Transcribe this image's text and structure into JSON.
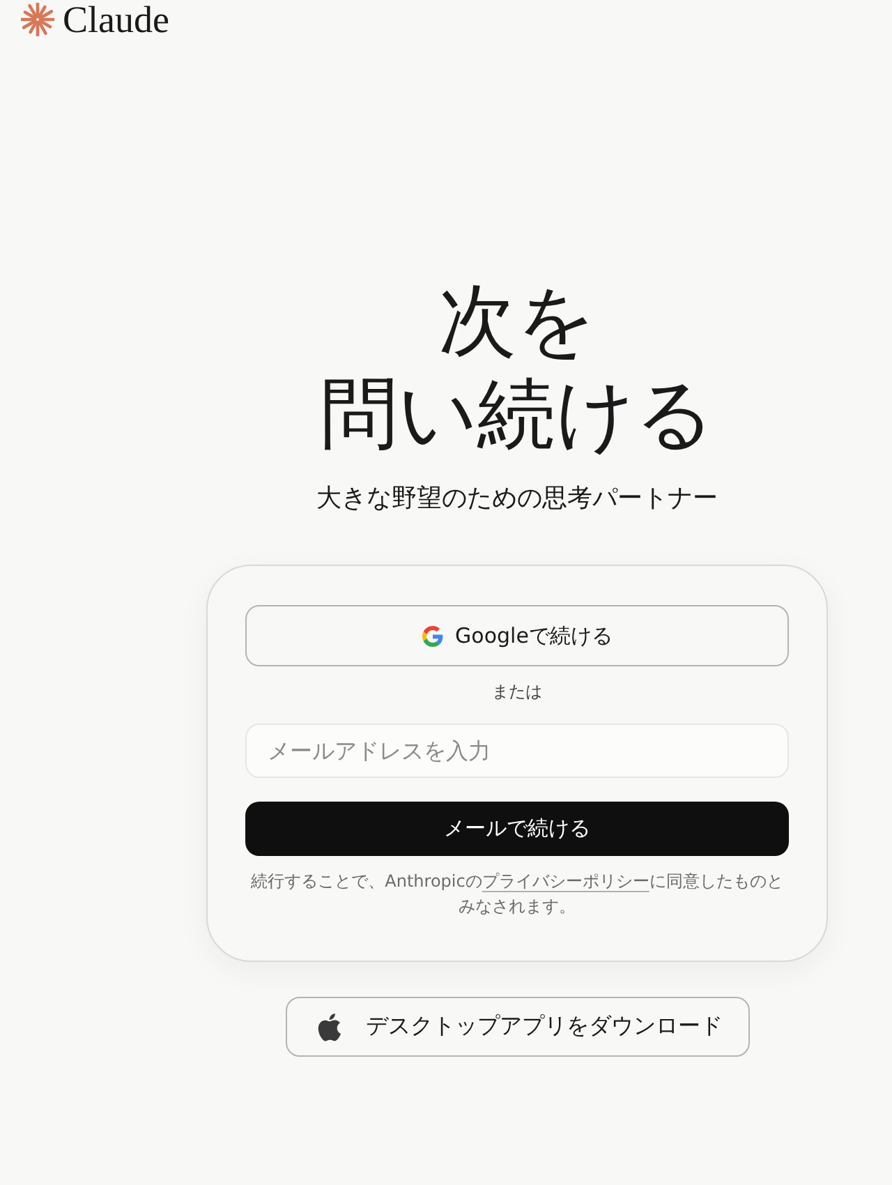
{
  "header": {
    "logo_text": "Claude"
  },
  "hero": {
    "title_lines": [
      "次を",
      "問い続ける"
    ],
    "subtitle": "大きな野望のための思考パートナー"
  },
  "login_card": {
    "google_button": "Googleで続ける",
    "divider_text": "または",
    "email_field": {
      "placeholder": "メールアドレスを入力"
    },
    "email_button": "メールで続ける",
    "terms": {
      "before": "続行することで、Anthropicの",
      "link": "プライバシーポリシー",
      "after": "に同意したものとみなされます。"
    }
  },
  "download_button": "デスクトップアプリをダウンロード"
}
